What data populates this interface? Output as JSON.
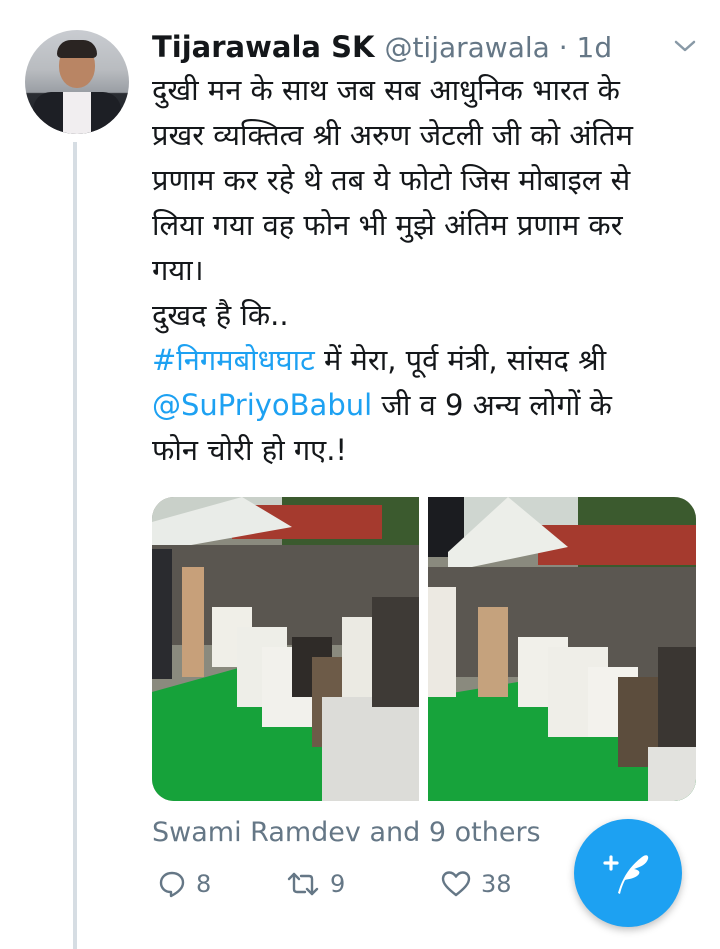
{
  "tweet": {
    "author_name": "Tijarawala SK",
    "handle_time": "@tijarawala · 1d",
    "text_lines": [
      "दुखी मन के साथ जब सब आधुनिक भारत के",
      "प्रखर व्यक्तित्व श्री अरुण जेटली जी को अंतिम",
      "प्रणाम कर रहे थे तब ये फोटो जिस मोबाइल से",
      "लिया गया वह फोन भी मुझे अंतिम प्रणाम कर",
      "गया।",
      "दुखद है कि.."
    ],
    "hashtag": "#निगमबोधघाट",
    "line7_rest": " में मेरा, पूर्व मंत्री, सांसद श्री",
    "mention": "@SuPriyoBabul",
    "line8_rest": " जी व 9 अन्य लोगों के",
    "line9": "फोन चोरी हो गए.!",
    "liked_by": "Swami Ramdev and 9 others",
    "reply_count": "8",
    "retweet_count": "9",
    "like_count": "38"
  },
  "icons": {
    "chevron": "chevron-down-icon",
    "reply": "reply-icon",
    "retweet": "retweet-icon",
    "like": "heart-icon",
    "compose": "compose-tweet-icon"
  },
  "colors": {
    "link": "#1da1f2",
    "muted": "#657786",
    "fab": "#1da1f2"
  }
}
